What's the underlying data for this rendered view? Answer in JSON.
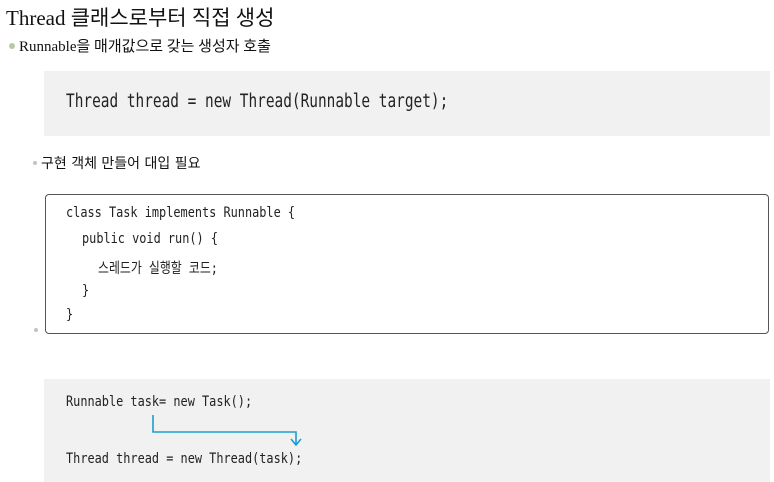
{
  "title": "Thread 클래스로부터 직접 생성",
  "bullet": {
    "text": "Runnable을 매개값으로 갖는 생성자 호출",
    "dot_color": "#b9c8a4"
  },
  "code1": {
    "line": "Thread thread = new Thread(Runnable target);"
  },
  "sub_bullet": {
    "text": "구현 객체 만들어 대입 필요"
  },
  "class_code": {
    "lines": [
      "class Task implements Runnable {",
      "public void run() {",
      "스레드가 실행할 코드;",
      "}",
      "}"
    ]
  },
  "code2": {
    "line1": "Runnable task= new Task();",
    "line2": "Thread thread = new Thread(task);",
    "arrow_color": "#1a9fd0"
  }
}
